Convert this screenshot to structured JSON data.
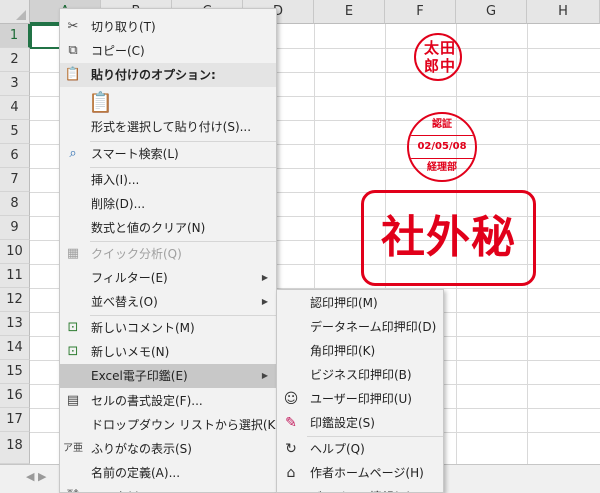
{
  "columns": [
    "A",
    "B",
    "C",
    "D",
    "E",
    "F",
    "G",
    "H"
  ],
  "rows": [
    "1",
    "2",
    "3",
    "4",
    "5",
    "6",
    "7",
    "8",
    "9",
    "10",
    "11",
    "12",
    "13",
    "14",
    "15",
    "16",
    "17",
    "18"
  ],
  "stamps": {
    "name": {
      "c1": "太",
      "c2": "田",
      "c3": "郎",
      "c4": "中"
    },
    "date": {
      "top": "認証",
      "date": "02/05/08",
      "bottom": "経理部"
    },
    "secret": "社外秘"
  },
  "context_menu": {
    "cut": "切り取り(T)",
    "copy": "コピー(C)",
    "paste_options": "貼り付けのオプション:",
    "paste_special": "形式を選択して貼り付け(S)...",
    "smart_lookup": "スマート検索(L)",
    "insert": "挿入(I)...",
    "delete": "削除(D)...",
    "clear_contents": "数式と値のクリア(N)",
    "quick_analysis": "クイック分析(Q)",
    "filter": "フィルター(E)",
    "sort": "並べ替え(O)",
    "new_comment": "新しいコメント(M)",
    "new_note": "新しいメモ(N)",
    "excel_stamp": "Excel電子印鑑(E)",
    "format_cells": "セルの書式設定(F)...",
    "dropdown_pick": "ドロップダウン リストから選択(K)...",
    "phonetic": "ふりがなの表示(S)",
    "define_name": "名前の定義(A)...",
    "link": "リンク(I)"
  },
  "submenu": {
    "stamp_recognized": "認印押印(M)",
    "stamp_dataname": "データネーム印押印(D)",
    "stamp_square": "角印押印(K)",
    "stamp_business": "ビジネス印押印(B)",
    "stamp_user": "ユーザー印押印(U)",
    "stamp_settings": "印鑑設定(S)",
    "help": "ヘルプ(Q)",
    "author_home": "作者ホームページ(H)",
    "version_info": "バージョン情報(V)"
  },
  "colors": {
    "accent": "#217346",
    "stamp_red": "#e1001a",
    "menu_bg": "#f2f2f2",
    "highlight": "#c8c8c8"
  },
  "icons": {
    "cut": "scissors-icon",
    "copy": "copy-icon",
    "paste": "clipboard-icon",
    "search": "search-icon",
    "quick_analysis": "quick-analysis-icon",
    "comment": "new-comment-icon",
    "note": "new-note-icon",
    "format": "format-cells-icon",
    "phonetic": "phonetic-icon",
    "user": "smiley-icon",
    "settings": "stamp-settings-icon",
    "help": "help-icon",
    "home": "home-icon",
    "version": "version-icon"
  }
}
